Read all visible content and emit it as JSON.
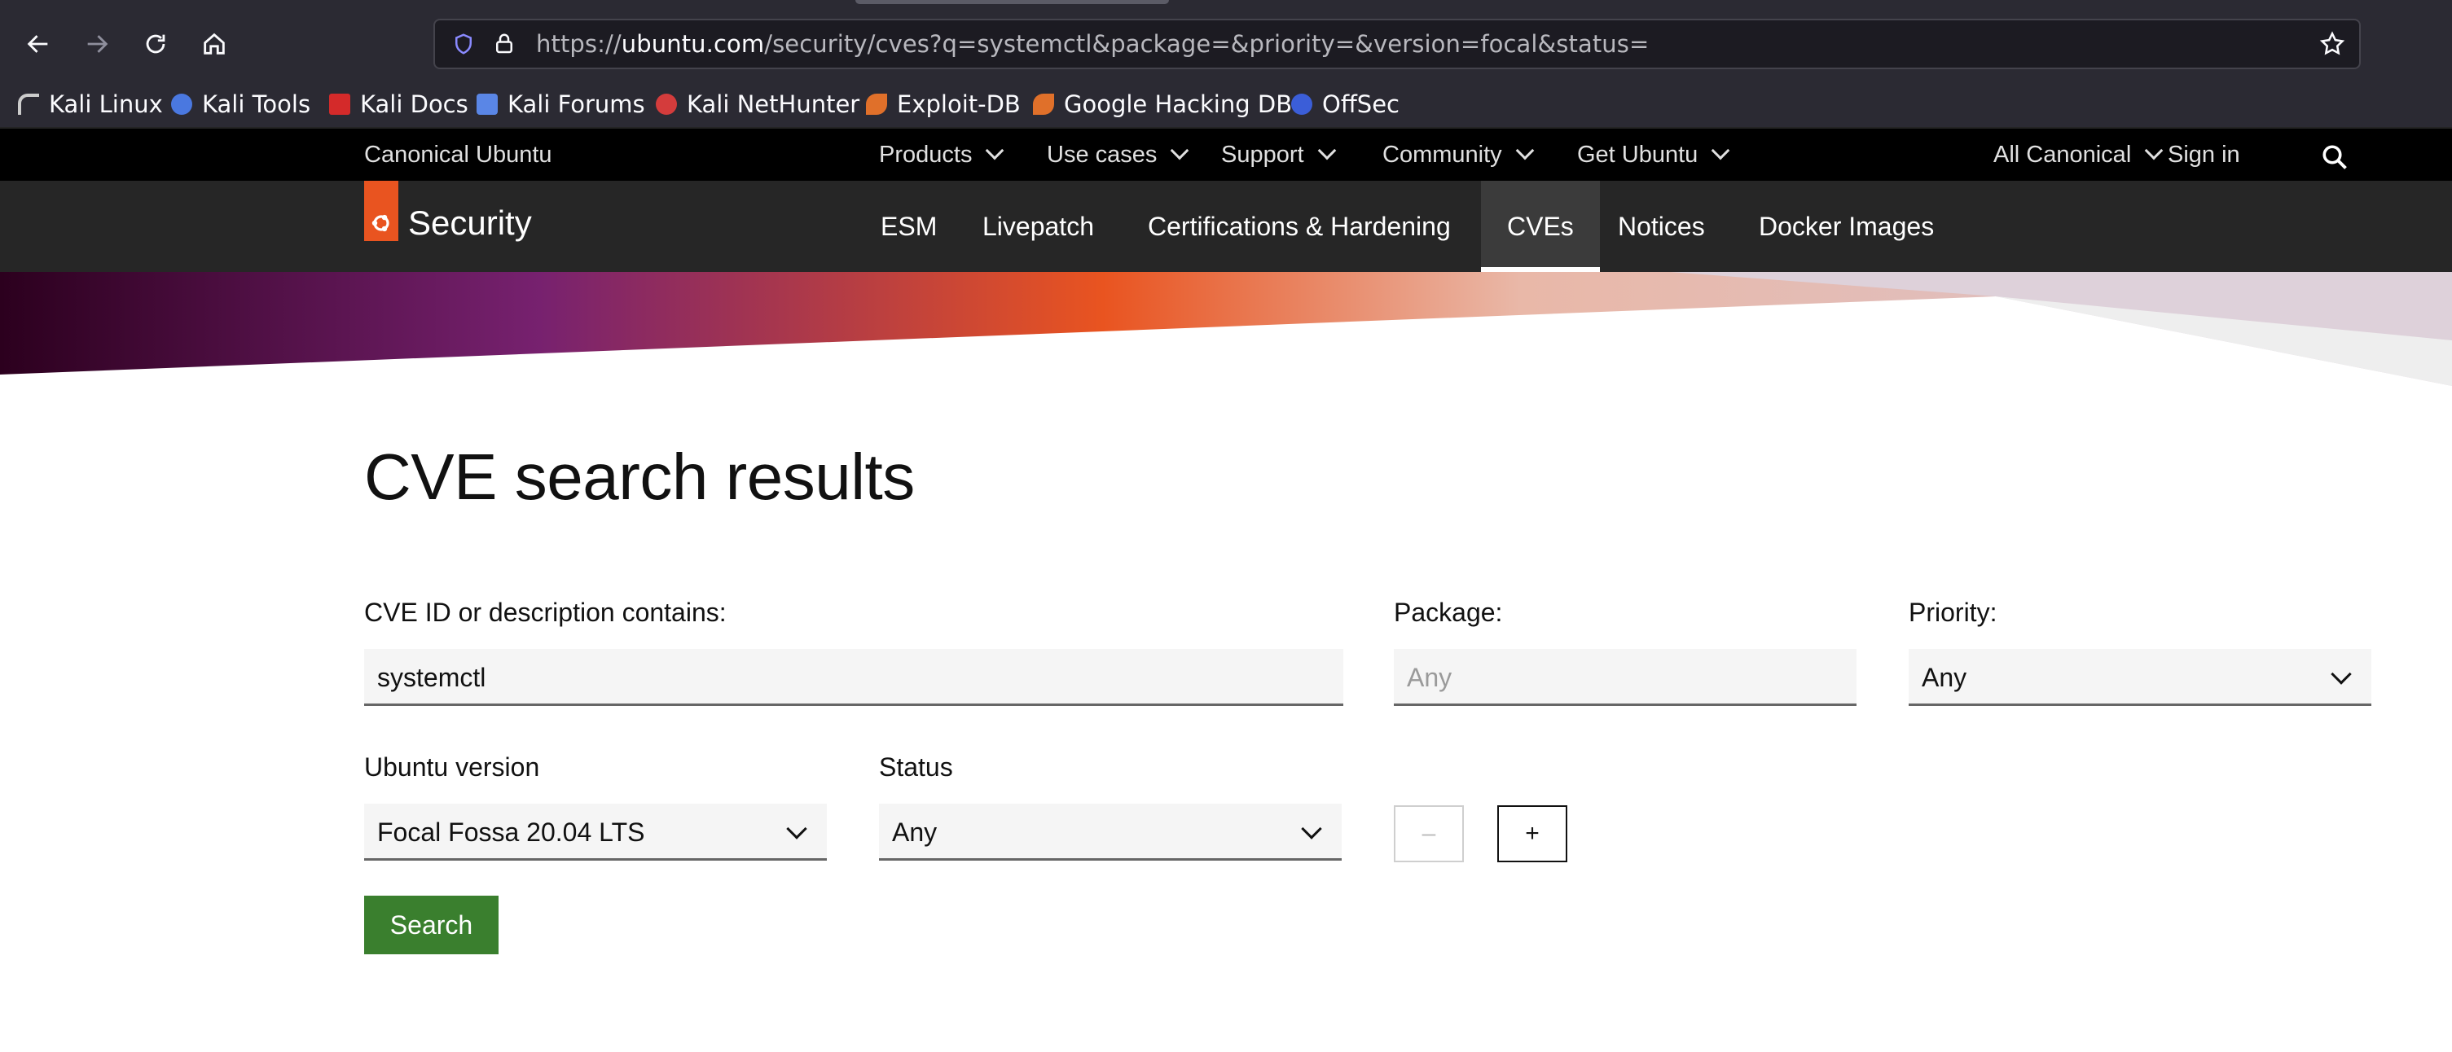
{
  "browser": {
    "url_prefix": "https://",
    "url_host": "ubuntu.com",
    "url_path": "/security/cves?q=systemctl&package=&priority=&version=focal&status=",
    "bookmarks": [
      {
        "label": "Kali Linux",
        "icon": "kali-dragon-icon"
      },
      {
        "label": "Kali Tools",
        "icon": "kali-tools-icon"
      },
      {
        "label": "Kali Docs",
        "icon": "kali-docs-icon"
      },
      {
        "label": "Kali Forums",
        "icon": "kali-forums-icon"
      },
      {
        "label": "Kali NetHunter",
        "icon": "kali-nethunter-icon"
      },
      {
        "label": "Exploit-DB",
        "icon": "exploit-db-icon"
      },
      {
        "label": "Google Hacking DB",
        "icon": "ghdb-icon"
      },
      {
        "label": "OffSec",
        "icon": "offsec-icon"
      }
    ]
  },
  "global_nav": {
    "brand": "Canonical Ubuntu",
    "items": [
      "Products",
      "Use cases",
      "Support",
      "Community",
      "Get Ubuntu"
    ],
    "all_canonical": "All Canonical",
    "sign_in": "Sign in"
  },
  "sub_nav": {
    "title": "Security",
    "items": [
      "ESM",
      "Livepatch",
      "Certifications & Hardening",
      "CVEs",
      "Notices",
      "Docker Images"
    ],
    "active": "CVEs"
  },
  "main": {
    "title": "CVE search results",
    "query_label": "CVE ID or description contains:",
    "query_value": "systemctl",
    "package_label": "Package:",
    "package_placeholder": "Any",
    "priority_label": "Priority:",
    "priority_value": "Any",
    "version_label": "Ubuntu version",
    "version_value": "Focal Fossa 20.04 LTS",
    "status_label": "Status",
    "status_value": "Any",
    "minus_label": "–",
    "plus_label": "+",
    "search_label": "Search"
  },
  "colors": {
    "ubuntu_orange": "#E95420",
    "search_green": "#3A7F2E",
    "chrome_bg": "#2B2A33"
  }
}
